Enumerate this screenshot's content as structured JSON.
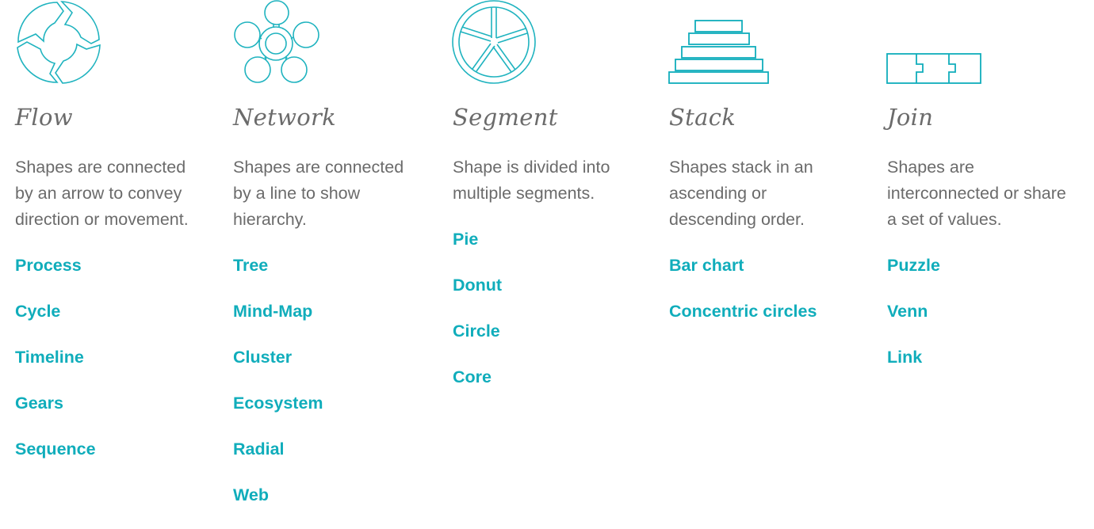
{
  "accent_color": "#10adbb",
  "text_color": "#6b6b6b",
  "categories": [
    {
      "id": "flow",
      "icon": "cycle-arrows-icon",
      "title": "Flow",
      "description_lines": [
        "Shapes are connected",
        "by an arrow to convey",
        "direction or movement."
      ],
      "items": [
        "Process",
        "Cycle",
        "Timeline",
        "Gears",
        "Sequence"
      ]
    },
    {
      "id": "network",
      "icon": "network-nodes-icon",
      "title": "Network",
      "description_lines": [
        "Shapes are connected",
        "by a line to show",
        "hierarchy."
      ],
      "items": [
        "Tree",
        "Mind-Map",
        "Cluster",
        "Ecosystem",
        "Radial",
        "Web"
      ]
    },
    {
      "id": "segment",
      "icon": "pie-segments-icon",
      "title": "Segment",
      "description_lines": [
        "Shape is divided into",
        "multiple  segments."
      ],
      "items": [
        "Pie",
        "Donut",
        "Circle",
        "Core"
      ]
    },
    {
      "id": "stack",
      "icon": "stacked-bars-icon",
      "title": "Stack",
      "description_lines": [
        "Shapes stack in an",
        "ascending or",
        "descending order."
      ],
      "items": [
        "Bar chart",
        "Concentric circles"
      ]
    },
    {
      "id": "join",
      "icon": "puzzle-pieces-icon",
      "title": "Join",
      "description_lines": [
        "Shapes are",
        "interconnected or share",
        "a set of values."
      ],
      "items": [
        "Puzzle",
        "Venn",
        "Link"
      ]
    }
  ]
}
